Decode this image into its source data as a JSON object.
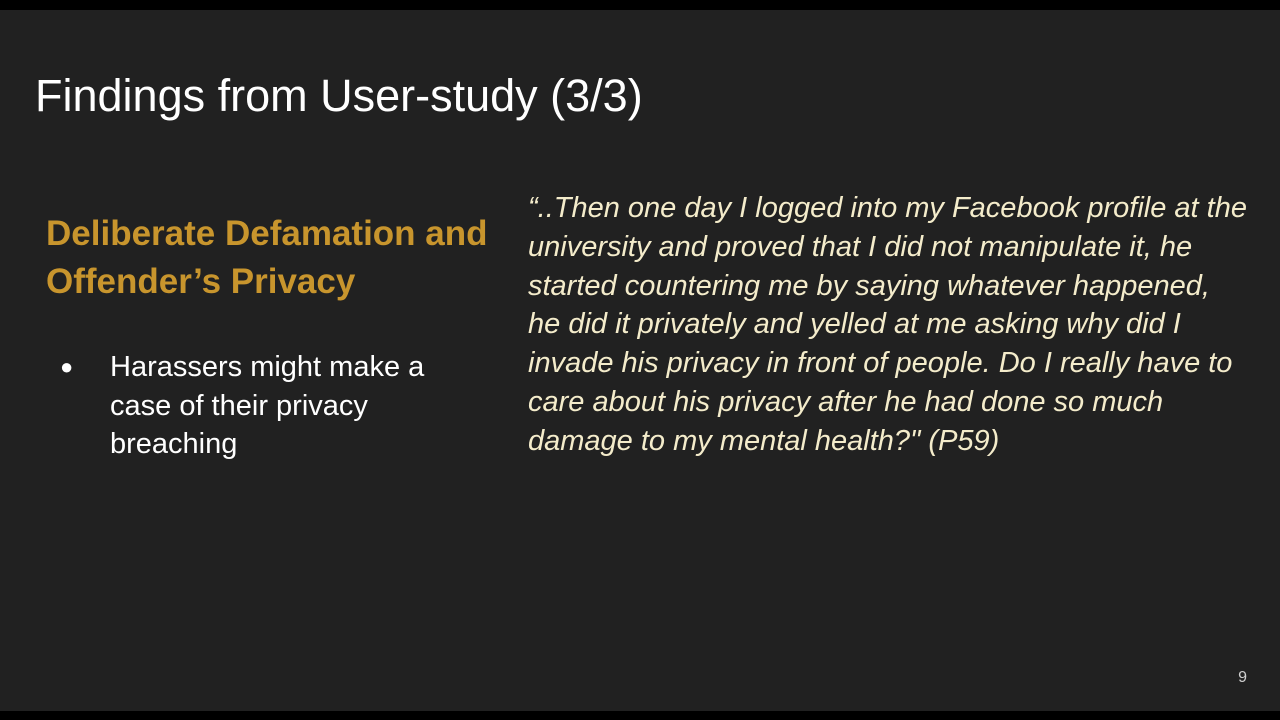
{
  "slide": {
    "title": "Findings from User-study (3/3)",
    "subheading": "Deliberate Defamation and Offender’s Privacy",
    "bullets": [
      {
        "symbol": "●",
        "text": "Harassers might make a case of their privacy breaching"
      }
    ],
    "quote": "“..Then one day I logged into my Facebook profile at the university and proved that I did not manipulate it, he started countering me by saying whatever happened, he did it privately and yelled at me asking why did I invade his privacy in front of people. Do I really have to care about his privacy after he had done so much damage to my mental health?\" (P59)",
    "page_number": "9"
  },
  "colors": {
    "background": "#212121",
    "letterbox": "#000000",
    "title": "#ffffff",
    "subheading": "#c8952d",
    "quote": "#f4eccb"
  }
}
